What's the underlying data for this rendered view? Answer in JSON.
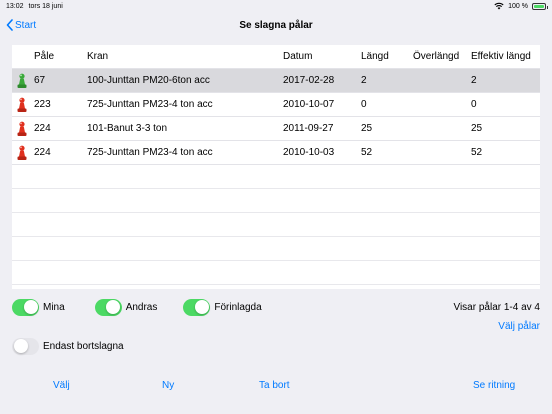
{
  "status_bar": {
    "time": "13:02",
    "date": "tors 18 juni",
    "battery": "100 %"
  },
  "nav": {
    "back_label": "Start",
    "title": "Se slagna pålar"
  },
  "table": {
    "columns": [
      "Påle",
      "Kran",
      "Datum",
      "Längd",
      "Överlängd",
      "Effektiv längd"
    ],
    "rows": [
      {
        "icon": "green-pile-icon",
        "pale": "67",
        "kran": "100-Junttan PM20-6ton acc",
        "datum": "2017-02-28",
        "langd": "2",
        "overlangd": "",
        "effektiv": "2",
        "selected": true
      },
      {
        "icon": "red-pile-icon",
        "pale": "223",
        "kran": "725-Junttan PM23-4 ton acc",
        "datum": "2010-10-07",
        "langd": "0",
        "overlangd": "",
        "effektiv": "0",
        "selected": false
      },
      {
        "icon": "red-pile-icon",
        "pale": "224",
        "kran": "101-Banut 3-3 ton",
        "datum": "2011-09-27",
        "langd": "25",
        "overlangd": "",
        "effektiv": "25",
        "selected": false
      },
      {
        "icon": "red-pile-icon",
        "pale": "224",
        "kran": "725-Junttan PM23-4 ton acc",
        "datum": "2010-10-03",
        "langd": "52",
        "overlangd": "",
        "effektiv": "52",
        "selected": false
      }
    ]
  },
  "filters": {
    "mina": {
      "label": "Mina",
      "on": true
    },
    "andras": {
      "label": "Andras",
      "on": true
    },
    "forinlagda": {
      "label": "Förinlagda",
      "on": true
    },
    "endast_bortslagna": {
      "label": "Endast bortslagna",
      "on": false
    }
  },
  "count_label": "Visar pålar 1-4 av 4",
  "select_piles_label": "Välj pålar",
  "toolbar": {
    "valj": "Välj",
    "ny": "Ny",
    "ta_bort": "Ta bort",
    "se_ritning": "Se ritning"
  },
  "colors": {
    "accent": "#007aff",
    "toggle_on": "#4cd964",
    "pawn_green": "#3aa83a",
    "pawn_red": "#e0301e"
  }
}
